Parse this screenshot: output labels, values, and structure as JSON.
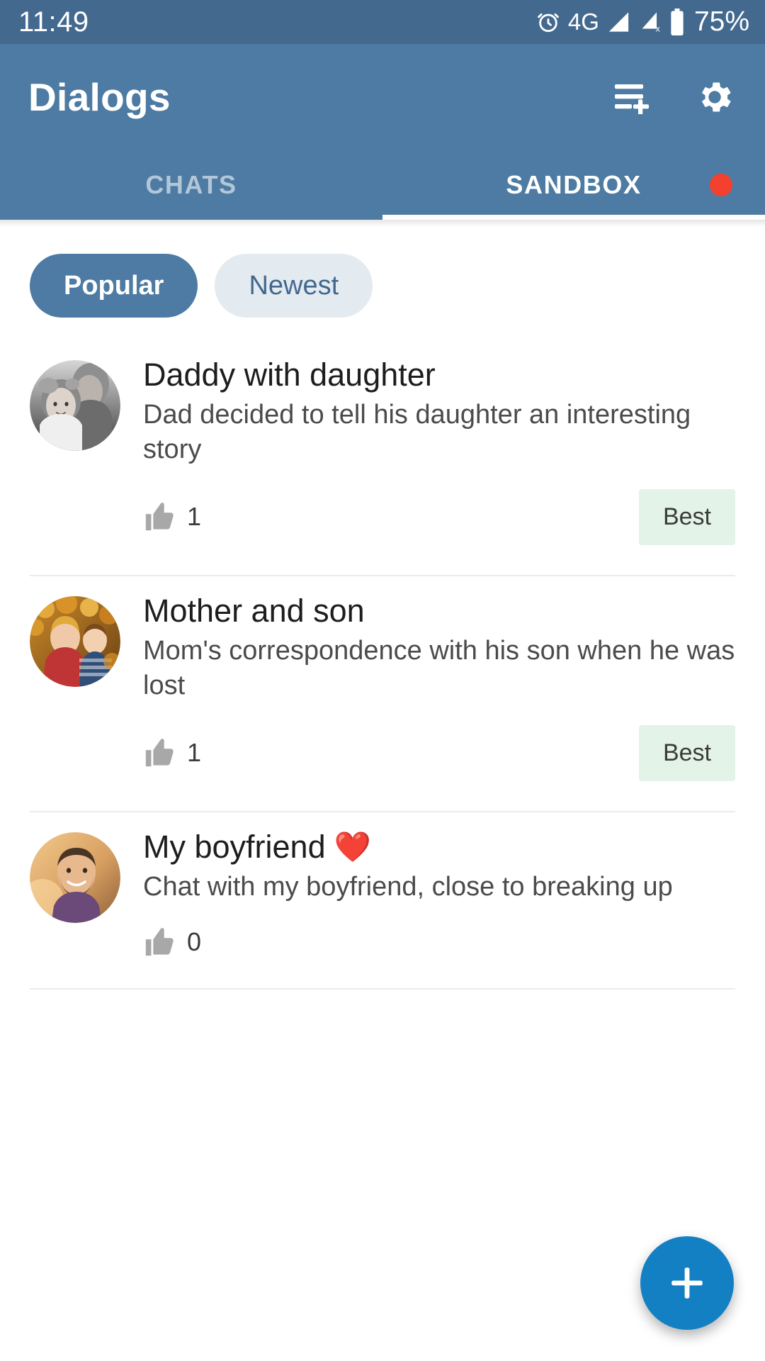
{
  "status_bar": {
    "time": "11:49",
    "network": "4G",
    "battery_percent": "75%",
    "icons": [
      "alarm-icon",
      "signal-icon",
      "signal-no-service-icon",
      "battery-icon"
    ]
  },
  "app_bar": {
    "title": "Dialogs",
    "actions": [
      {
        "name": "new-dialog-icon",
        "label": "playlist-add-icon"
      },
      {
        "name": "settings-icon",
        "label": "gear-icon"
      }
    ]
  },
  "tabs": [
    {
      "label": "CHATS",
      "active": false,
      "badge": false
    },
    {
      "label": "SANDBOX",
      "active": true,
      "badge": true
    }
  ],
  "filters": [
    {
      "label": "Popular",
      "selected": true
    },
    {
      "label": "Newest",
      "selected": false
    }
  ],
  "list": [
    {
      "title": "Daddy with daughter",
      "title_emoji": "",
      "subtitle": "Dad decided to tell his daughter an interesting story",
      "likes": "1",
      "badge": "Best",
      "avatar": "photo-dad-and-daughter-bw"
    },
    {
      "title": "Mother and son",
      "title_emoji": "",
      "subtitle": "Mom's correspondence with his son when he was lost",
      "likes": "1",
      "badge": "Best",
      "avatar": "photo-mother-and-son-autumn"
    },
    {
      "title": "My boyfriend",
      "title_emoji": "❤️",
      "subtitle": "Chat with my boyfriend, close to breaking up",
      "likes": "0",
      "badge": "",
      "avatar": "photo-bearded-man-sunset"
    }
  ],
  "fab": {
    "label": "+",
    "name": "add-dialog-fab"
  },
  "colors": {
    "status_bar": "#44698f",
    "app_bar": "#4d7ba3",
    "chip_selected": "#4d7ba3",
    "chip_unselected": "#e3ebf0",
    "badge_red": "#f4402f",
    "best_badge_bg": "#e3f3e7",
    "fab": "#1380c4",
    "heart": "#e0342b"
  }
}
